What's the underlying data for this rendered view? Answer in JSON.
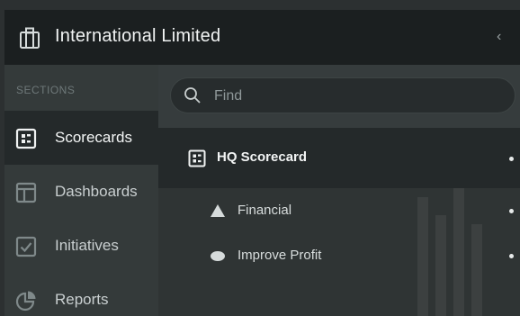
{
  "header": {
    "org_name": "International Limited",
    "org_icon": "briefcase-icon",
    "collapse_icon": "chevron-left-icon",
    "collapse_glyph": "‹"
  },
  "sidebar": {
    "section_label": "SECTIONS",
    "items": [
      {
        "label": "Scorecards",
        "icon": "scorecard-icon",
        "active": true
      },
      {
        "label": "Dashboards",
        "icon": "dashboard-icon",
        "active": false
      },
      {
        "label": "Initiatives",
        "icon": "checkbox-icon",
        "active": false
      },
      {
        "label": "Reports",
        "icon": "pie-chart-icon",
        "active": false
      }
    ]
  },
  "search": {
    "placeholder": "Find",
    "icon": "search-icon"
  },
  "tree": {
    "root": {
      "label": "HQ Scorecard",
      "icon": "scorecard-icon"
    },
    "children": [
      {
        "label": "Financial",
        "icon": "triangle-icon"
      },
      {
        "label": "Improve Profit",
        "icon": "oval-icon"
      }
    ]
  },
  "colors": {
    "header_bg": "#1b1f20",
    "sidebar_bg": "#343a3a",
    "active_bg": "#24292a",
    "text": "#f2f4f4"
  }
}
